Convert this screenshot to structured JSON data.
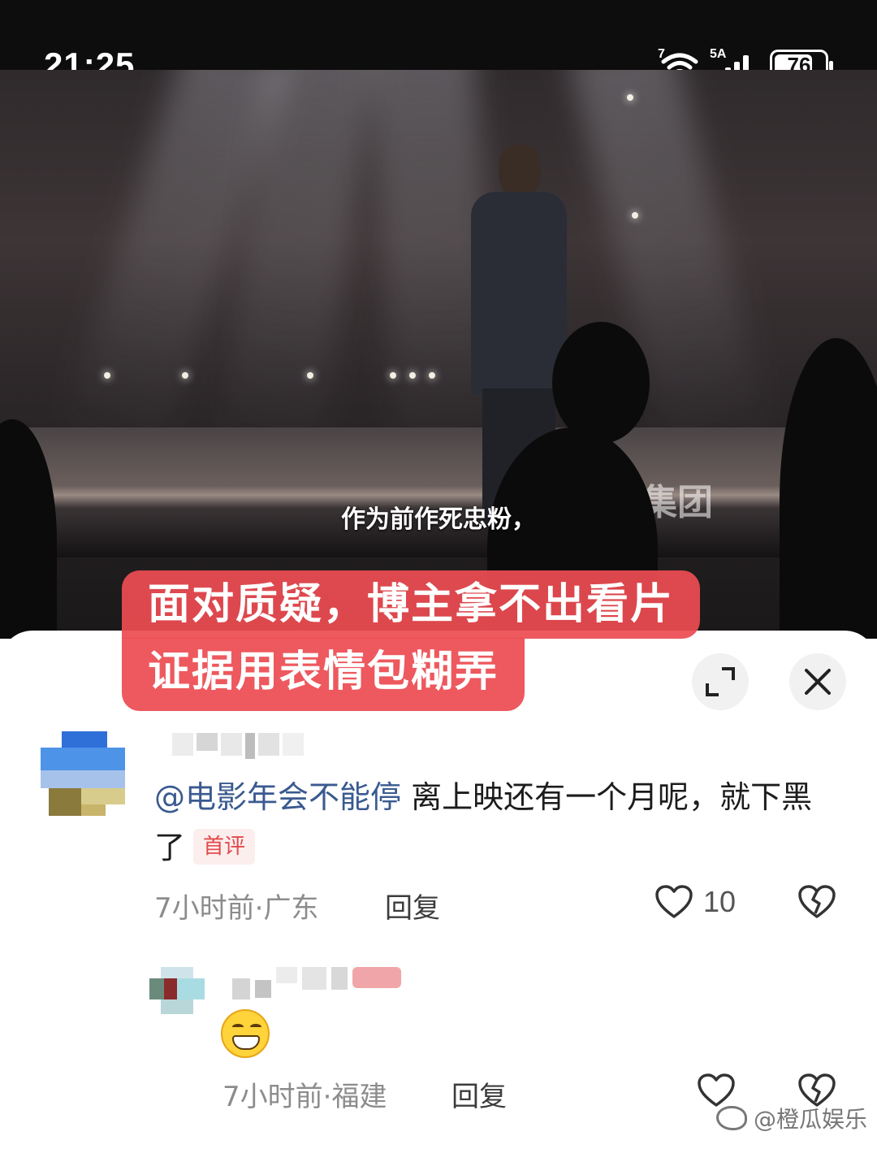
{
  "status_bar": {
    "time": "21:25",
    "wifi_tag": "7",
    "signal_tag": "5A",
    "battery_percent": "76",
    "battery_level": 0.76
  },
  "video": {
    "subtitle": "作为前作死忠粉，",
    "background_sign": "集团"
  },
  "caption": {
    "line1": "面对质疑，博主拿不出看片",
    "line2": "证据用表情包糊弄",
    "background_color": "#EC4C52"
  },
  "sheet": {
    "expand_icon": "expand-icon",
    "close_icon": "close-icon"
  },
  "comments": [
    {
      "username": "",
      "mention": "@电影年会不能停",
      "text": " 离上映还有一个月呢，就下黑了",
      "badge": "首评",
      "meta": "7小时前·广东",
      "reply_label": "回复",
      "like_count": "10",
      "like_icon": "heart-outline-icon",
      "dislike_icon": "broken-heart-icon"
    },
    {
      "username": "",
      "emoji": "grinning-face-emoji",
      "meta": "7小时前·福建",
      "reply_label": "回复",
      "like_icon": "heart-outline-icon",
      "dislike_icon": "broken-heart-icon"
    }
  ],
  "watermark": {
    "text": "@橙瓜娱乐",
    "logo": "weibo-logo"
  },
  "colors": {
    "mention": "#3A5A8F",
    "badge": "#E24A4A",
    "meta": "#8C8C8C"
  }
}
